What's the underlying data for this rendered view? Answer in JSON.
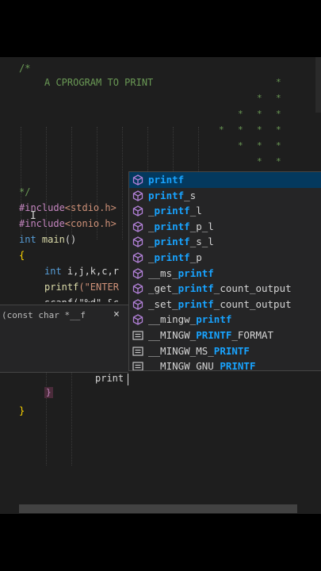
{
  "code": {
    "comment_open": "/*",
    "comment_title": "A CPROGRAM TO PRINT",
    "comment_close": "*/",
    "include1_kw": "#include",
    "include1_hdr": "<stdio.h>",
    "include2_kw": "#include",
    "include2_hdr": "<conio.h>",
    "main_type": "int",
    "main_name": " main",
    "main_parens": "()",
    "open_brace": "{",
    "decl_type": "int",
    "decl_vars": " i,j,k,c,r",
    "printf_call": "printf",
    "printf_args": "(\"ENTER",
    "scanf_partial": "scanf(\"%d\" &c",
    "typed_text": "print",
    "inner_brace": "}",
    "close_brace": "}",
    "pattern_char": "*"
  },
  "hint": {
    "signature": "(const char *__f",
    "close_glyph": "×"
  },
  "suggestions": [
    {
      "prefix": "",
      "match": "printf",
      "suffix": "",
      "icon": "cube-icon",
      "selected": true
    },
    {
      "prefix": "",
      "match": "printf",
      "suffix": "_s",
      "icon": "cube-icon",
      "selected": false
    },
    {
      "prefix": "_",
      "match": "printf",
      "suffix": "_l",
      "icon": "cube-icon",
      "selected": false
    },
    {
      "prefix": "_",
      "match": "printf",
      "suffix": "_p_l",
      "icon": "cube-icon",
      "selected": false
    },
    {
      "prefix": "_",
      "match": "printf",
      "suffix": "_s_l",
      "icon": "cube-icon",
      "selected": false
    },
    {
      "prefix": "_",
      "match": "printf",
      "suffix": "_p",
      "icon": "cube-icon",
      "selected": false
    },
    {
      "prefix": "__ms_",
      "match": "printf",
      "suffix": "",
      "icon": "cube-icon",
      "selected": false
    },
    {
      "prefix": "_get_",
      "match": "printf",
      "suffix": "_count_output",
      "icon": "cube-icon",
      "selected": false
    },
    {
      "prefix": "_set_",
      "match": "printf",
      "suffix": "_count_output",
      "icon": "cube-icon",
      "selected": false
    },
    {
      "prefix": "__mingw_",
      "match": "printf",
      "suffix": "",
      "icon": "cube-icon",
      "selected": false
    },
    {
      "prefix": "__MINGW_",
      "match": "PRINTF",
      "suffix": "_FORMAT",
      "icon": "text-icon",
      "selected": false
    },
    {
      "prefix": "__MINGW_MS_",
      "match": "PRINTF",
      "suffix": "",
      "icon": "text-icon",
      "selected": false
    },
    {
      "prefix": "__MINGW_GNU_",
      "match": "PRINTF",
      "suffix": "",
      "icon": "text-icon",
      "selected": false
    }
  ],
  "colors": {
    "editor_bg": "#1e1e1e",
    "suggest_bg": "#252526",
    "selected_bg": "#04395e",
    "match": "#18a3ff",
    "method_icon": "#b180d7"
  }
}
